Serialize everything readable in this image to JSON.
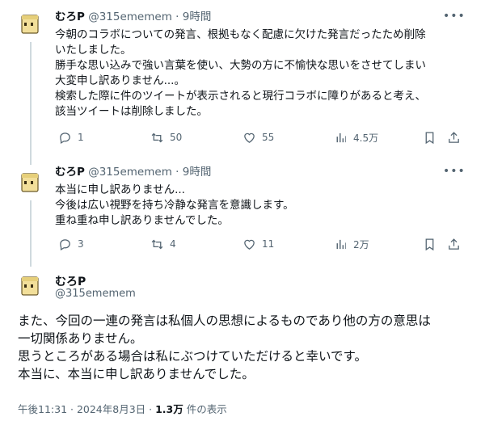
{
  "tweets": [
    {
      "name": "むろP",
      "handle": "@315ememem",
      "dot": "·",
      "time": "9時間",
      "lines": [
        "今朝のコラボについての発言、根拠もなく配慮に欠けた発言だったため削除",
        "いたしました。",
        "勝手な思い込みで強い言葉を使い、大勢の方に不愉快な思いをさせてしまい",
        "大変申し訳ありません...。",
        "検索した際に件のツイートが表示されると現行コラボに障りがあると考え、",
        "該当ツイートは削除しました。"
      ],
      "replies": "1",
      "retweets": "50",
      "likes": "55",
      "views": "4.5万"
    },
    {
      "name": "むろP",
      "handle": "@315ememem",
      "dot": "·",
      "time": "9時間",
      "lines": [
        "本当に申し訳ありません...",
        "今後は広い視野を持ち冷静な発言を意識します。",
        "重ね重ね申し訳ありませんでした。"
      ],
      "replies": "3",
      "retweets": "4",
      "likes": "11",
      "views": "2万"
    }
  ],
  "main": {
    "name": "むろP",
    "handle": "@315ememem",
    "lines": [
      "また、今回の一連の発言は私個人の思想によるものであり他の方の意思は",
      "一切関係ありません。",
      "思うところがある場合は私にぶつけていただけると幸いです。",
      "本当に、本当に申し訳ありませんでした。"
    ],
    "timestamp": "午後11:31 · 2024年8月3日 · ",
    "views_count": "1.3万",
    "views_label": " 件の表示"
  },
  "colors": {
    "avatar_fill": "#f2df9a",
    "avatar_stroke": "#6b5a2a",
    "muted": "#536471",
    "thread_line": "#cfd9de"
  },
  "icons": [
    "reply-icon",
    "retweet-icon",
    "like-icon",
    "views-icon",
    "bookmark-icon",
    "share-icon",
    "more-icon"
  ]
}
